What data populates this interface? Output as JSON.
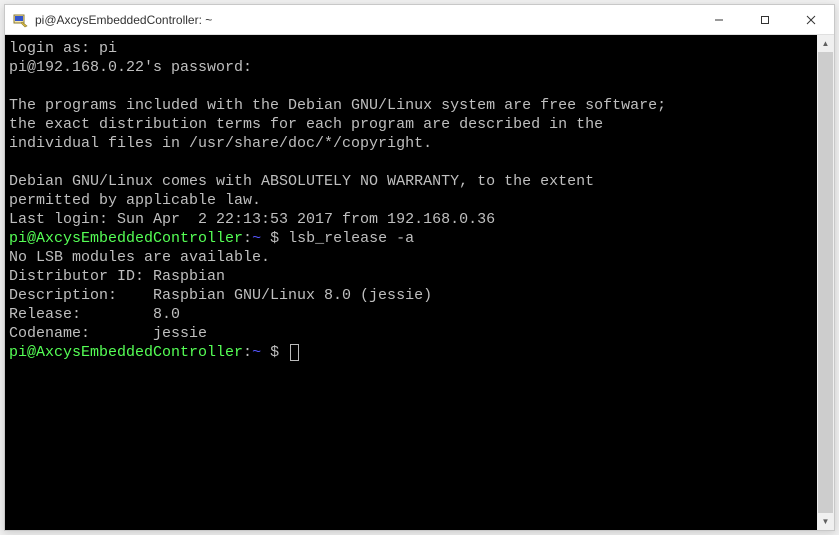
{
  "window": {
    "title": "pi@AxcysEmbeddedController: ~",
    "icon_name": "putty-icon"
  },
  "terminal": {
    "login_as_label": "login as: ",
    "login_user": "pi",
    "password_line": "pi@192.168.0.22's password:",
    "motd_line1": "The programs included with the Debian GNU/Linux system are free software;",
    "motd_line2": "the exact distribution terms for each program are described in the",
    "motd_line3": "individual files in /usr/share/doc/*/copyright.",
    "motd_line4": "Debian GNU/Linux comes with ABSOLUTELY NO WARRANTY, to the extent",
    "motd_line5": "permitted by applicable law.",
    "last_login": "Last login: Sun Apr  2 22:13:53 2017 from 192.168.0.36",
    "prompt_user_host": "pi@AxcysEmbeddedController",
    "prompt_colon": ":",
    "prompt_path": "~",
    "prompt_dollar": " $ ",
    "command1": "lsb_release -a",
    "out_no_lsb": "No LSB modules are available.",
    "out_dist_id": "Distributor ID: Raspbian",
    "out_desc": "Description:    Raspbian GNU/Linux 8.0 (jessie)",
    "out_release": "Release:        8.0",
    "out_codename": "Codename:       jessie"
  }
}
